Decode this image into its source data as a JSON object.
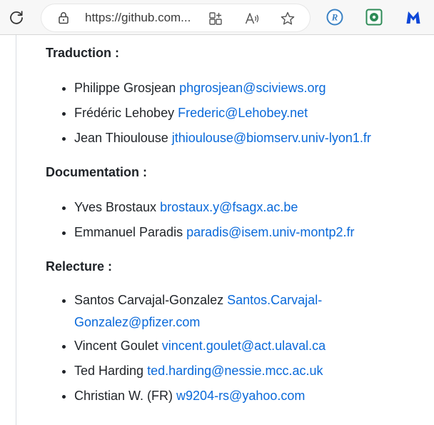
{
  "browser": {
    "url": "https://github.com...",
    "icons": {
      "reload": "reload-icon",
      "lock": "lock-icon",
      "split": "split-screen-icon",
      "read_aloud": "read-aloud-icon",
      "favorite": "favorite-star-icon"
    },
    "extensions": [
      "r-extension-icon",
      "green-extension-icon",
      "malwarebytes-icon"
    ]
  },
  "sections": [
    {
      "title": "Traduction :",
      "people": [
        {
          "name": "Philippe Grosjean",
          "email": "phgrosjean@sciviews.org"
        },
        {
          "name": "Frédéric Lehobey",
          "email": "Frederic@Lehobey.net"
        },
        {
          "name": "Jean Thioulouse",
          "email": "jthioulouse@biomserv.univ-lyon1.fr"
        }
      ]
    },
    {
      "title": "Documentation :",
      "people": [
        {
          "name": "Yves Brostaux",
          "email": "brostaux.y@fsagx.ac.be"
        },
        {
          "name": "Emmanuel Paradis",
          "email": "paradis@isem.univ-montp2.fr"
        }
      ]
    },
    {
      "title": "Relecture :",
      "people": [
        {
          "name": "Santos Carvajal-Gonzalez",
          "email_part1": "Santos.Carvajal-",
          "email_part2": "Gonzalez@pfizer.com"
        },
        {
          "name": "Vincent Goulet",
          "email": "vincent.goulet@act.ulaval.ca"
        },
        {
          "name": "Ted Harding",
          "email": "ted.harding@nessie.mcc.ac.uk"
        },
        {
          "name": "Christian W. (FR)",
          "email": "w9204-rs@yahoo.com"
        }
      ]
    }
  ],
  "colors": {
    "link": "#0969da",
    "text": "#1f2328"
  }
}
